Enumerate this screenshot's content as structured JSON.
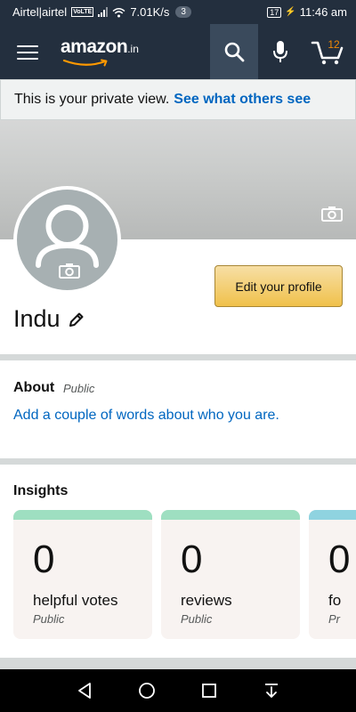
{
  "status_bar": {
    "carrier": "Airtel|airtel",
    "volte": "VoLTE",
    "speed": "7.01K/s",
    "notifications": "3",
    "battery": "17",
    "time": "11:46 am"
  },
  "header": {
    "logo_text": "amazon",
    "logo_suffix": ".in",
    "cart_count": "12",
    "icons": [
      "menu-icon",
      "search-icon",
      "mic-icon",
      "cart-icon"
    ]
  },
  "banner": {
    "text": "This is your private view.",
    "link": "See what others see"
  },
  "profile": {
    "name": "Indu",
    "edit_button": "Edit your profile"
  },
  "about": {
    "title": "About",
    "visibility": "Public",
    "link": "Add a couple of words about who you are."
  },
  "insights": {
    "title": "Insights",
    "cards": [
      {
        "value": "0",
        "label": "helpful votes",
        "visibility": "Public",
        "color": "#9edfc1"
      },
      {
        "value": "0",
        "label": "reviews",
        "visibility": "Public",
        "color": "#9edfc1"
      },
      {
        "value": "0",
        "label": "fo",
        "visibility": "Pr",
        "color": "#8fd3e0"
      }
    ]
  },
  "colors": {
    "header_bg": "#232f3e",
    "link": "#0066c0",
    "button_yellow": "#f0c14b",
    "cart_orange": "#f08804"
  }
}
